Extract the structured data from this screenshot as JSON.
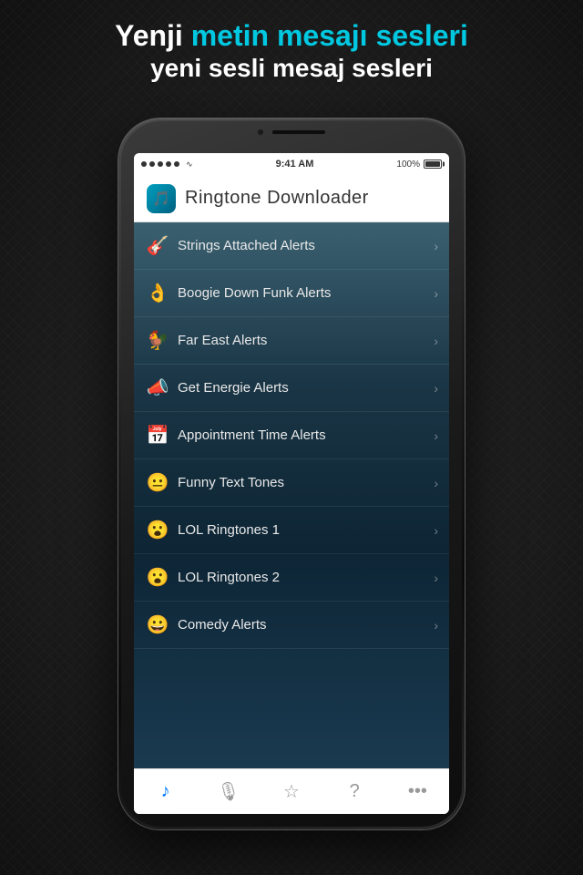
{
  "background": {
    "color": "#1a1a1a"
  },
  "header": {
    "line1_plain": "Yenji ",
    "line1_accent": "metin mesajı sesleri",
    "line2": "yeni sesli mesaj sesleri",
    "accent_color": "#00c8e0"
  },
  "status_bar": {
    "signal_dots": 5,
    "wifi": "WiFi",
    "time": "9:41 AM",
    "battery_pct": "100%"
  },
  "nav": {
    "title": "Ringtone Downloader",
    "icon_emoji": "🎵"
  },
  "list_items": [
    {
      "id": 1,
      "emoji": "🎸",
      "label": "Strings Attached Alerts"
    },
    {
      "id": 2,
      "emoji": "👌",
      "label": "Boogie Down Funk Alerts"
    },
    {
      "id": 3,
      "emoji": "🐓",
      "label": "Far East Alerts"
    },
    {
      "id": 4,
      "emoji": "📣",
      "label": "Get Energie Alerts"
    },
    {
      "id": 5,
      "emoji": "📅",
      "label": "Appointment Time Alerts"
    },
    {
      "id": 6,
      "emoji": "😐",
      "label": "Funny Text Tones"
    },
    {
      "id": 7,
      "emoji": "😮",
      "label": "LOL Ringtones 1"
    },
    {
      "id": 8,
      "emoji": "😮",
      "label": "LOL Ringtones 2"
    },
    {
      "id": 9,
      "emoji": "😀",
      "label": "Comedy Alerts"
    }
  ],
  "tab_bar": {
    "items": [
      {
        "id": "music",
        "icon": "♪",
        "active": true
      },
      {
        "id": "mic",
        "icon": "🎤",
        "active": false
      },
      {
        "id": "star",
        "icon": "☆",
        "active": false
      },
      {
        "id": "help",
        "icon": "?",
        "active": false
      },
      {
        "id": "more",
        "icon": "•••",
        "active": false
      }
    ]
  }
}
